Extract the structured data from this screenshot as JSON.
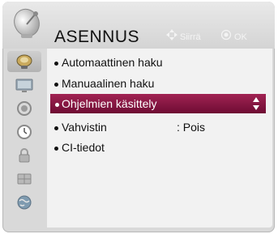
{
  "header": {
    "title": "ASENNUS",
    "hint_move": "Siirrä",
    "hint_ok": "OK"
  },
  "sidebar": {
    "items": [
      {
        "icon": "satellite-dish-icon",
        "active": true
      },
      {
        "icon": "tv-picture-icon",
        "active": false
      },
      {
        "icon": "speaker-audio-icon",
        "active": false
      },
      {
        "icon": "clock-icon",
        "active": false
      },
      {
        "icon": "lock-icon",
        "active": false
      },
      {
        "icon": "option-grid-icon",
        "active": false
      },
      {
        "icon": "network-globe-icon",
        "active": false
      }
    ]
  },
  "menu": {
    "items": [
      {
        "label": "Automaattinen haku"
      },
      {
        "label": "Manuaalinen haku"
      },
      {
        "label": "Ohjelmien käsittely",
        "selected": true
      },
      {
        "label": "Vahvistin",
        "value": ": Pois"
      },
      {
        "label": "CI-tiedot"
      }
    ]
  },
  "colors": {
    "selection": "#8a1440",
    "panel": "#f2f2f2",
    "frame": "#d9d9d9"
  }
}
